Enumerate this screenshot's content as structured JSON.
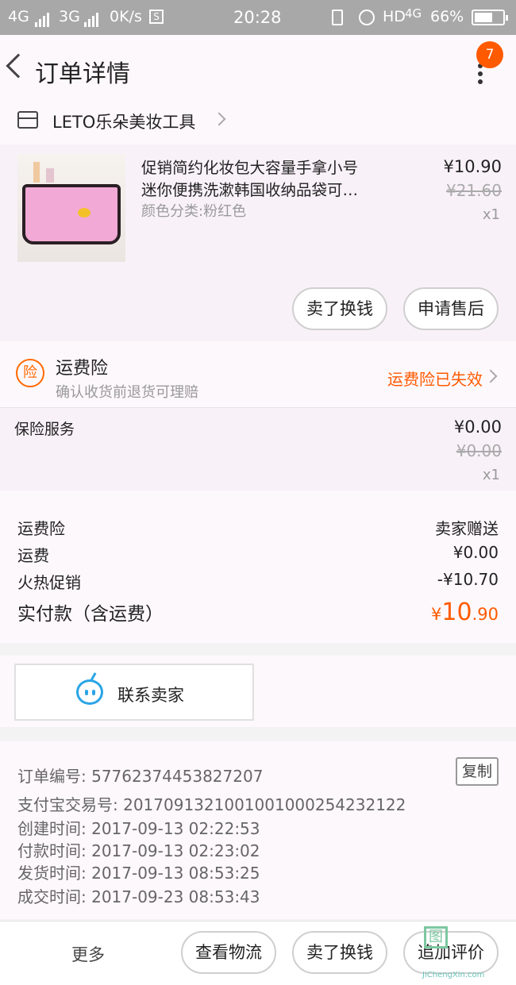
{
  "status_bar": {
    "net1": "4G",
    "net2": "3G",
    "speed": "0K/s",
    "time": "20:28",
    "hd": "HD",
    "net3": "4G",
    "battery": "66%",
    "battery_level": 0.66
  },
  "header": {
    "title": "订单详情",
    "badge": "7"
  },
  "shop": {
    "name": "LETO乐朵美妆工具"
  },
  "product": {
    "title_line1": "促销简约化妆包大容量手拿小号",
    "title_line2": "迷你便携洗漱韩国收纳品袋可…",
    "variant": "颜色分类:粉红色",
    "price": "¥10.90",
    "original_price": "¥21.60",
    "quantity": "x1",
    "sell_button": "卖了换钱",
    "aftersale_button": "申请售后"
  },
  "insurance": {
    "icon_text": "险",
    "title": "运费险",
    "subtitle": "确认收货前退货可理赔",
    "status": "运费险已失效"
  },
  "service": {
    "label": "保险服务",
    "price": "¥0.00",
    "original_price": "¥0.00",
    "quantity": "x1"
  },
  "summary": {
    "rows": [
      {
        "label": "运费险",
        "value": "卖家赠送"
      },
      {
        "label": "运费",
        "value": "¥0.00"
      },
      {
        "label": "火热促销",
        "value": "-¥10.70"
      }
    ],
    "paid_label": "实付款（含运费）",
    "paid_currency": "¥",
    "paid_int": "10",
    "paid_dec": ".90"
  },
  "contact": {
    "label": "联系卖家"
  },
  "order_info": {
    "order_no": "订单编号: 57762374453827207",
    "copy_label": "复制",
    "alipay_no": "支付宝交易号: 2017091321001001000254232122",
    "created": "创建时间: 2017-09-13 02:22:53",
    "paid": "付款时间: 2017-09-13 02:23:02",
    "shipped": "发货时间: 2017-09-13 08:53:25",
    "completed": "成交时间: 2017-09-23 08:53:43"
  },
  "bottom_bar": {
    "more": "更多",
    "logistics": "查看物流",
    "sell": "卖了换钱",
    "review": "追加评价"
  },
  "watermark": {
    "logo": "图",
    "text": "JiChengXin.com"
  },
  "colors": {
    "accent": "#ff5a00",
    "contact_blue": "#2aa4e6"
  }
}
